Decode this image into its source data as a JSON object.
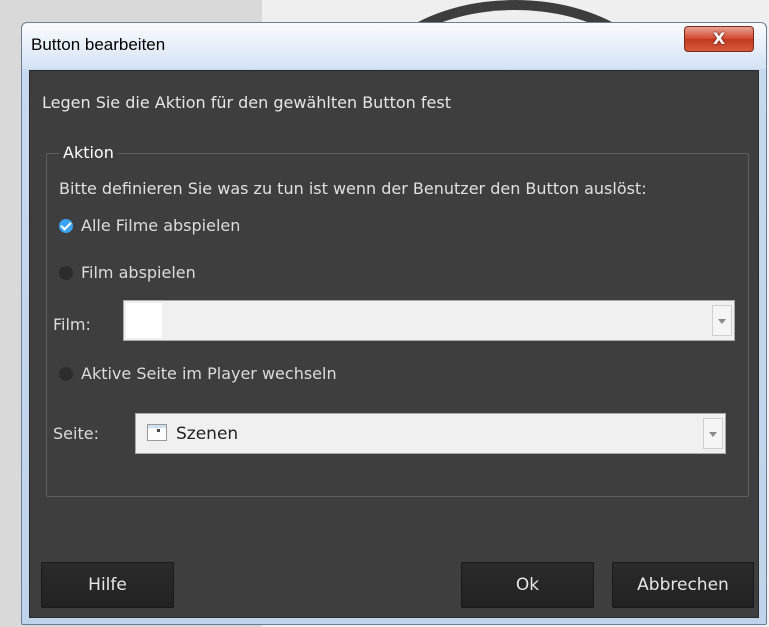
{
  "window": {
    "title": "Button bearbeiten",
    "close_label": "X"
  },
  "intro_text": "Legen Sie die Aktion für den gewählten Button fest",
  "action_group": {
    "title": "Aktion",
    "description": "Bitte definieren Sie was zu tun ist wenn der Benutzer den Button auslöst:",
    "options": [
      {
        "label": "Alle Filme abspielen",
        "checked": true
      },
      {
        "label": "Film abspielen",
        "checked": false
      },
      {
        "label": "Aktive Seite im Player wechseln",
        "checked": false
      }
    ],
    "film": {
      "label": "Film:",
      "value": ""
    },
    "page": {
      "label": "Seite:",
      "value": "Szenen",
      "icon": "page-icon"
    }
  },
  "buttons": {
    "help": "Hilfe",
    "ok": "Ok",
    "cancel": "Abbrechen"
  },
  "colors": {
    "dialog_bg": "#3e3e3e",
    "accent": "#3aa3f2",
    "close_red": "#d1472d"
  }
}
